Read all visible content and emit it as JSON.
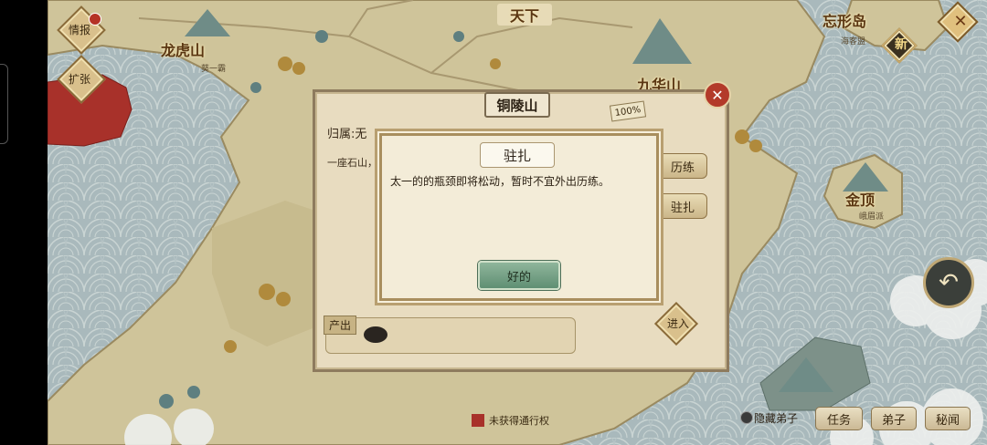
{
  "map": {
    "title": "天下",
    "regions": [
      {
        "name": "龙虎山",
        "sub": "葵一霸"
      },
      {
        "name": "忘形岛",
        "sub": "海客盟"
      },
      {
        "name": "九华山",
        "sub": ""
      },
      {
        "name": "金顶",
        "sub": "峨眉派"
      }
    ]
  },
  "left_buttons": {
    "intel": "情报",
    "expand": "扩张"
  },
  "new_badge": "新",
  "panel": {
    "title": "铜陵山",
    "progress": "100%",
    "owner_label": "归属:",
    "owner_value": "无",
    "description": "一座石山，山中多生野矿藏……",
    "train_button": "历练",
    "station_button": "驻扎",
    "output_label": "产出",
    "enter_button": "进入"
  },
  "dialog": {
    "title": "驻扎",
    "message": "太一的的瓶颈即将松动，暂时不宜外出历练。",
    "ok_button": "好的"
  },
  "footer": {
    "legend_text": "未获得通行权",
    "legend_color": "#a8312a",
    "hidden_disciples": "隐藏弟子",
    "tasks": "任务",
    "disciples": "弟子",
    "secrets": "秘闻"
  },
  "icons": {
    "close": "close-icon",
    "back": "back-arrow-icon",
    "settings": "diamond-cross-icon"
  }
}
